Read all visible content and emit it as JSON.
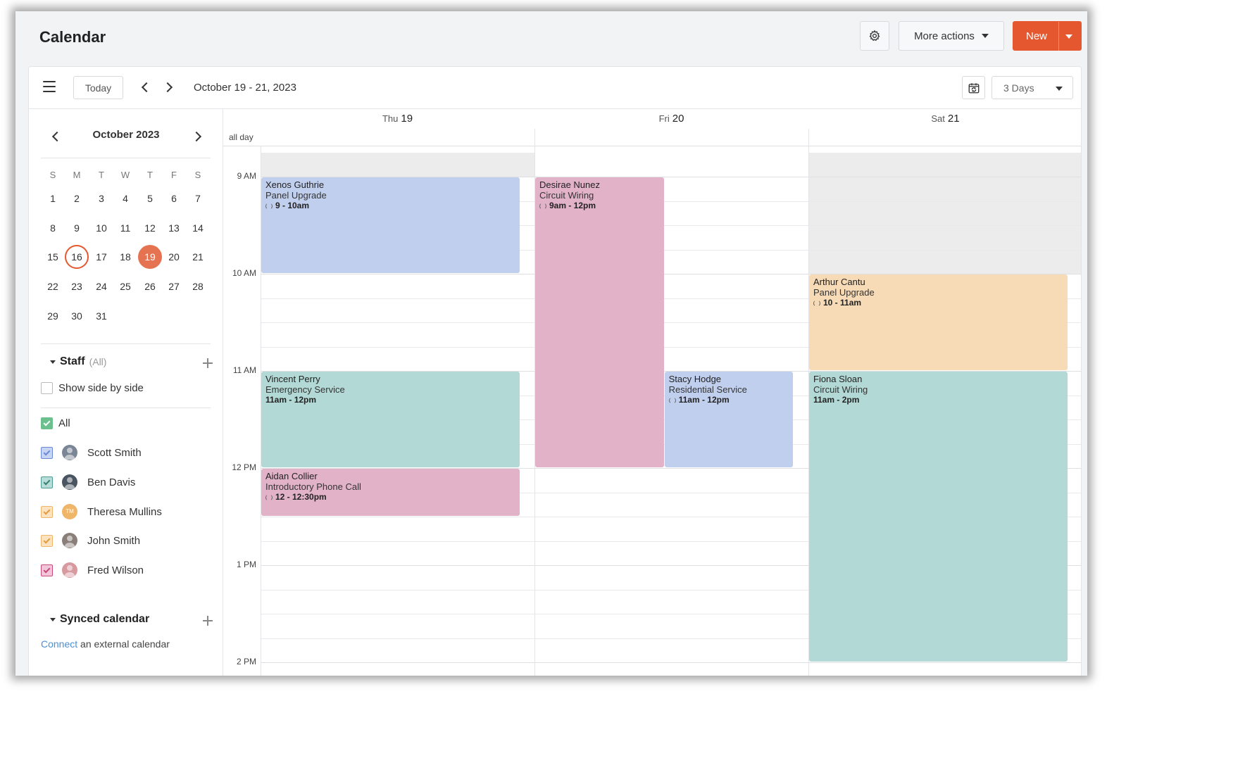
{
  "header": {
    "title": "Calendar",
    "more_actions_label": "More actions",
    "new_label": "New"
  },
  "toolbar": {
    "today_label": "Today",
    "date_range": "October 19 - 21, 2023",
    "view_label": "3 Days"
  },
  "mini_calendar": {
    "month_label": "October 2023",
    "weekdays": [
      "S",
      "M",
      "T",
      "W",
      "T",
      "F",
      "S"
    ],
    "weeks": [
      [
        "1",
        "2",
        "3",
        "4",
        "5",
        "6",
        "7"
      ],
      [
        "8",
        "9",
        "10",
        "11",
        "12",
        "13",
        "14"
      ],
      [
        "15",
        "16",
        "17",
        "18",
        "19",
        "20",
        "21"
      ],
      [
        "22",
        "23",
        "24",
        "25",
        "26",
        "27",
        "28"
      ],
      [
        "29",
        "30",
        "31"
      ]
    ],
    "today": "16",
    "selected": "19"
  },
  "staff": {
    "title": "Staff",
    "filter": "(All)",
    "side_by_side_label": "Show side by side",
    "all_label": "All",
    "members": [
      {
        "name": "Scott Smith",
        "color": "#6a8ad8"
      },
      {
        "name": "Ben Davis",
        "color": "#4c9c93"
      },
      {
        "name": "Theresa Mullins",
        "color": "#efb66a",
        "initials": "TM"
      },
      {
        "name": "John Smith",
        "color": "#efb66a"
      },
      {
        "name": "Fred Wilson",
        "color": "#c8497c"
      }
    ]
  },
  "synced": {
    "title": "Synced calendar",
    "connect_link": "Connect",
    "connect_rest": " an external calendar"
  },
  "grid": {
    "allday_label": "all day",
    "days": [
      {
        "dow": "Thu",
        "num": "19"
      },
      {
        "dow": "Fri",
        "num": "20"
      },
      {
        "dow": "Sat",
        "num": "21"
      }
    ],
    "time_labels": [
      "9 AM",
      "10 AM",
      "11 AM",
      "12 PM",
      "1 PM",
      "2 PM"
    ]
  },
  "events": [
    {
      "name": "Xenos Guthrie",
      "service": "Panel Upgrade",
      "time": "9 - 10am",
      "recurring": true
    },
    {
      "name": "Desirae Nunez",
      "service": "Circuit Wiring",
      "time": "9am - 12pm",
      "recurring": true
    },
    {
      "name": "Arthur Cantu",
      "service": "Panel Upgrade",
      "time": "10 - 11am",
      "recurring": true
    },
    {
      "name": "Vincent Perry",
      "service": "Emergency Service",
      "time": "11am - 12pm",
      "recurring": false
    },
    {
      "name": "Stacy Hodge",
      "service": "Residential Service",
      "time": "11am - 12pm",
      "recurring": true
    },
    {
      "name": "Fiona Sloan",
      "service": "Circuit Wiring",
      "time": "11am - 2pm",
      "recurring": false
    },
    {
      "name": "Aidan Collier",
      "service": "Introductory Phone Call",
      "time": "12 - 12:30pm",
      "recurring": true
    }
  ],
  "colors": {
    "accent": "#e5582f",
    "event_blue": "#c1cfee",
    "event_pink": "#e2b2c9",
    "event_teal": "#b2d9d5",
    "event_orange": "#f7dab6"
  }
}
